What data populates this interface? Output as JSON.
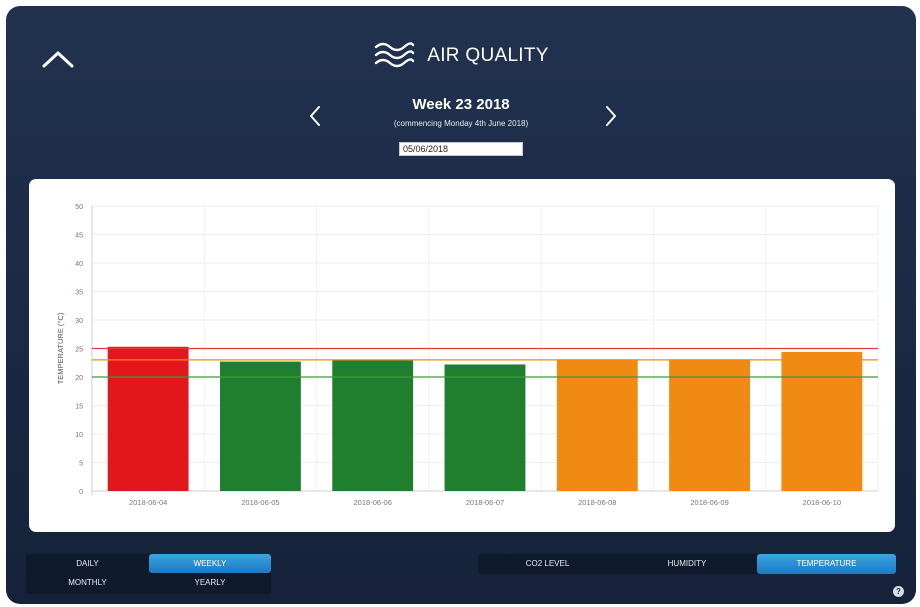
{
  "header": {
    "title": "AIR QUALITY",
    "title_icon": "wind-waves-icon",
    "collapse_icon": "chevron-up-icon"
  },
  "week_nav": {
    "title": "Week 23 2018",
    "subtitle": "(commencing Monday 4th June 2018)",
    "date_value": "05/06/2018",
    "prev_icon": "chevron-left-icon",
    "next_icon": "chevron-right-icon"
  },
  "chart_data": {
    "type": "bar",
    "ylabel": "TEMPERATURE (°C)",
    "xlabel": "",
    "ylim": [
      0,
      50
    ],
    "yticks": [
      "0",
      "5",
      "10",
      "15",
      "20",
      "25",
      "30",
      "35",
      "40",
      "45",
      "50"
    ],
    "categories": [
      "2018-06-04",
      "2018-06-05",
      "2018-06-06",
      "2018-06-07",
      "2018-06-08",
      "2018-06-09",
      "2018-06-10"
    ],
    "values": [
      25.3,
      22.7,
      22.9,
      22.2,
      23.1,
      23.1,
      24.4
    ],
    "bar_colors": [
      "#e3161c",
      "#1f7f2e",
      "#1f7f2e",
      "#1f7f2e",
      "#f08a12",
      "#f08a12",
      "#f08a12"
    ],
    "reference_lines": [
      {
        "value": 25,
        "color": "#e8343a"
      },
      {
        "value": 23,
        "color": "#f08a12"
      },
      {
        "value": 20,
        "color": "#3f9a3a"
      }
    ],
    "grid": true
  },
  "period_buttons": {
    "daily": "DAILY",
    "weekly": "WEEKLY",
    "monthly": "MONTHLY",
    "yearly": "YEARLY",
    "active": "weekly"
  },
  "category_buttons": {
    "co2": "CO2 LEVEL",
    "humidity": "HUMIDITY",
    "temperature": "TEMPERATURE",
    "active": "temperature"
  },
  "help": {
    "icon": "help-icon",
    "symbol": "?"
  },
  "colors": {
    "background": "#1a2944",
    "accent": "#2b8fd6"
  }
}
